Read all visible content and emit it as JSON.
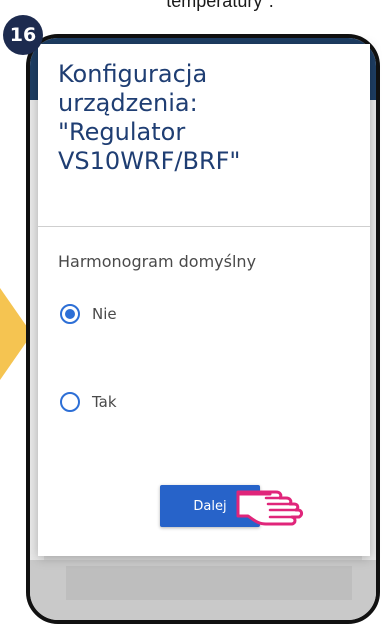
{
  "caption": {
    "text": "temperatury\"."
  },
  "step": {
    "number": "16"
  },
  "dialog": {
    "title_lines": [
      "Konfiguracja",
      "urządzenia:",
      "\"Regulator",
      "VS10WRF/BRF\""
    ],
    "section_label": "Harmonogram domyślny",
    "options": [
      {
        "label": "Nie",
        "selected": true
      },
      {
        "label": "Tak",
        "selected": false
      }
    ],
    "next_label": "Dalej"
  },
  "colors": {
    "step_badge": "#1d2b4f",
    "arrow": "#f5c451",
    "title_text": "#1f3e73",
    "accent": "#2763c9",
    "radio": "#2d6fd6",
    "hand_outline": "#e0257a",
    "header": "#1e3e64"
  },
  "icons": {
    "hand": "pointing-hand-icon",
    "arrow": "arrow-right-icon"
  }
}
